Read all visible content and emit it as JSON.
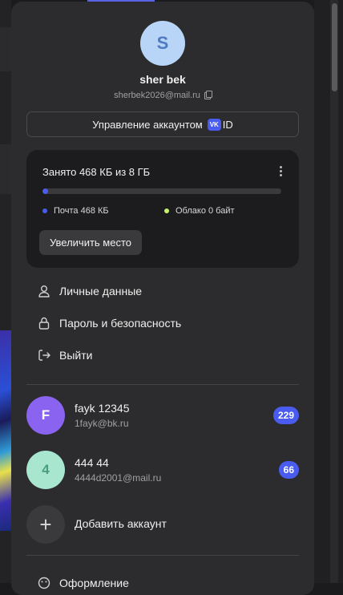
{
  "user": {
    "initial": "S",
    "name": "sher bek",
    "email": "sherbek2026@mail.ru"
  },
  "manage_account": {
    "label": "Управление аккаунтом",
    "vk_badge": "VK",
    "id_suffix": "ID"
  },
  "storage": {
    "title": "Занято 468 КБ из 8 ГБ",
    "used_fraction": 0.02,
    "mail_label": "Почта 468 КБ",
    "cloud_label": "Облако 0 байт",
    "increase_label": "Увеличить место"
  },
  "menu": {
    "items": [
      {
        "label": "Личные данные",
        "icon": "person-icon"
      },
      {
        "label": "Пароль и безопасность",
        "icon": "lock-icon"
      },
      {
        "label": "Выйти",
        "icon": "logout-icon"
      }
    ]
  },
  "accounts": [
    {
      "initial": "F",
      "name": "fayk 12345",
      "email": "1fayk@bk.ru",
      "badge": "229"
    },
    {
      "initial": "4",
      "name": "444 44",
      "email": "4444d2001@mail.ru",
      "badge": "66"
    }
  ],
  "add_account": {
    "label": "Добавить аккаунт",
    "symbol": "+"
  },
  "footer_item": {
    "label": "Оформление",
    "icon": "theme-icon"
  },
  "colors": {
    "accent": "#4a5cf0",
    "mail_dot": "#4a5cf0",
    "cloud_dot": "#c6f36b",
    "avatar_main": "#b8d5f7",
    "avatar_fayk": "#8a63f0",
    "avatar_444": "#a8e6d0"
  }
}
